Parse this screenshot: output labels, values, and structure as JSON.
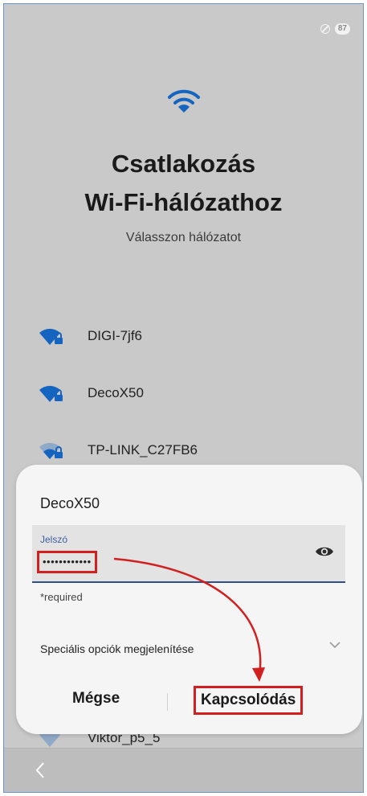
{
  "status": {
    "battery": "87"
  },
  "header": {
    "title_line1": "Csatlakozás",
    "title_line2": "Wi-Fi-hálózathoz",
    "subtitle": "Válasszon hálózatot"
  },
  "networks": [
    {
      "name": "DIGI-7jf6",
      "icon": "wifi-lock-icon"
    },
    {
      "name": "DecoX50",
      "icon": "wifi-lock-icon"
    },
    {
      "name": "TP-LINK_C27FB6",
      "icon": "wifi-lock-icon"
    },
    {
      "name": "Viktor_p5_5",
      "icon": "wifi-lock-icon"
    }
  ],
  "dialog": {
    "network_name": "DecoX50",
    "password_label": "Jelszó",
    "password_value": "••••••••••••",
    "required_text": "*required",
    "advanced_label": "Speciális opciók megjelenítése",
    "cancel_label": "Mégse",
    "connect_label": "Kapcsolódás"
  },
  "colors": {
    "background": "#c9c9c9",
    "wifi_blue": "#1565c0",
    "highlight_red": "#d21f1f",
    "field_underline": "#2f4f86"
  }
}
